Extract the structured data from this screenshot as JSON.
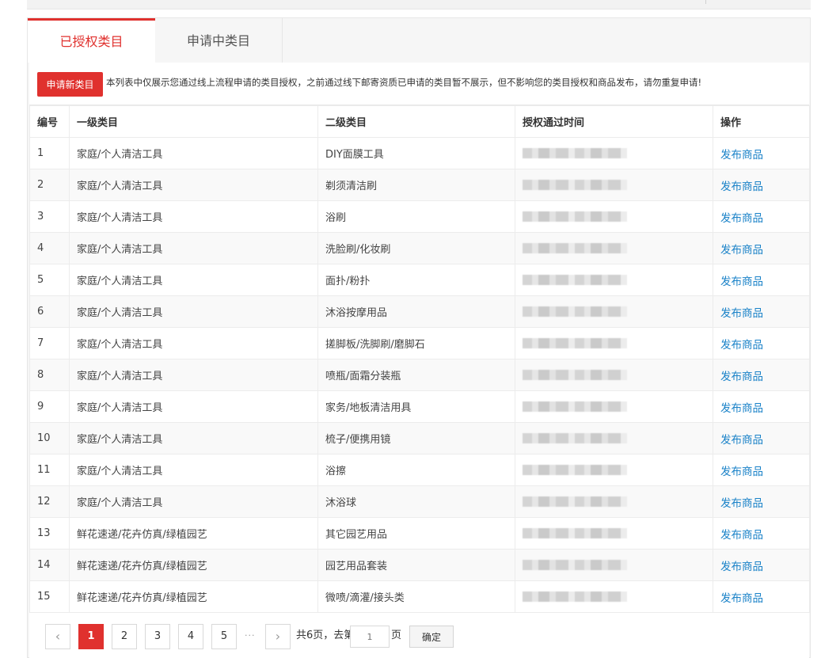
{
  "tabs": [
    {
      "label": "已授权类目",
      "active": true
    },
    {
      "label": "申请中类目",
      "active": false
    }
  ],
  "notice": {
    "apply_button": "申请新类目",
    "text": "本列表中仅展示您通过线上流程申请的类目授权，之前通过线下邮寄资质已申请的类目暂不展示，但不影响您的类目授权和商品发布，请勿重复申请!"
  },
  "table": {
    "headers": [
      "编号",
      "一级类目",
      "二级类目",
      "授权通过时间",
      "操作"
    ],
    "rows": [
      {
        "no": "1",
        "level1": "家庭/个人清洁工具",
        "level2": "DIY面膜工具",
        "action": "发布商品"
      },
      {
        "no": "2",
        "level1": "家庭/个人清洁工具",
        "level2": "剃须清洁刷",
        "action": "发布商品"
      },
      {
        "no": "3",
        "level1": "家庭/个人清洁工具",
        "level2": "浴刷",
        "action": "发布商品"
      },
      {
        "no": "4",
        "level1": "家庭/个人清洁工具",
        "level2": "洗脸刷/化妆刷",
        "action": "发布商品"
      },
      {
        "no": "5",
        "level1": "家庭/个人清洁工具",
        "level2": "面扑/粉扑",
        "action": "发布商品"
      },
      {
        "no": "6",
        "level1": "家庭/个人清洁工具",
        "level2": "沐浴按摩用品",
        "action": "发布商品"
      },
      {
        "no": "7",
        "level1": "家庭/个人清洁工具",
        "level2": "搓脚板/洗脚刷/磨脚石",
        "action": "发布商品"
      },
      {
        "no": "8",
        "level1": "家庭/个人清洁工具",
        "level2": "喷瓶/面霜分装瓶",
        "action": "发布商品"
      },
      {
        "no": "9",
        "level1": "家庭/个人清洁工具",
        "level2": "家务/地板清洁用具",
        "action": "发布商品"
      },
      {
        "no": "10",
        "level1": "家庭/个人清洁工具",
        "level2": "梳子/便携用镜",
        "action": "发布商品"
      },
      {
        "no": "11",
        "level1": "家庭/个人清洁工具",
        "level2": "浴擦",
        "action": "发布商品"
      },
      {
        "no": "12",
        "level1": "家庭/个人清洁工具",
        "level2": "沐浴球",
        "action": "发布商品"
      },
      {
        "no": "13",
        "level1": "鲜花速递/花卉仿真/绿植园艺",
        "level2": "其它园艺用品",
        "action": "发布商品"
      },
      {
        "no": "14",
        "level1": "鲜花速递/花卉仿真/绿植园艺",
        "level2": "园艺用品套装",
        "action": "发布商品"
      },
      {
        "no": "15",
        "level1": "鲜花速递/花卉仿真/绿植园艺",
        "level2": "微喷/滴灌/接头类",
        "action": "发布商品"
      }
    ]
  },
  "pagination": {
    "prev_icon": "chevron-left-icon",
    "next_icon": "chevron-right-icon",
    "pages": [
      "1",
      "2",
      "3",
      "4",
      "5"
    ],
    "current": "1",
    "ellipsis": "···",
    "total_text": "共6页，去第",
    "goto_placeholder": "1",
    "page_unit": "页",
    "confirm_label": "确定"
  }
}
